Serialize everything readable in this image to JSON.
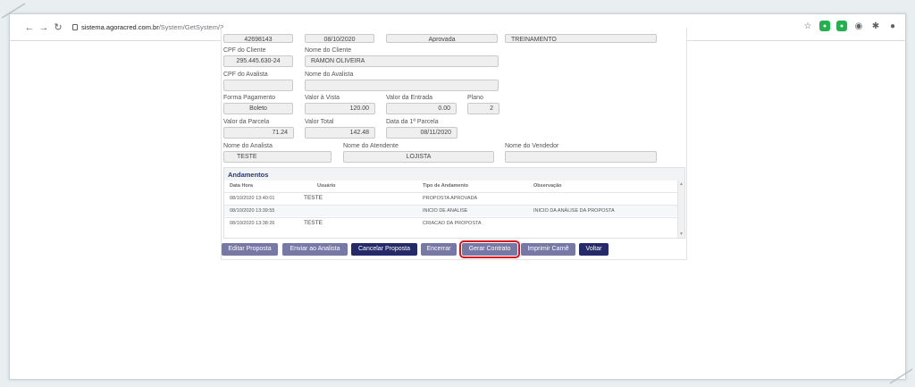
{
  "browser": {
    "url_host": "sistema.agoracred.com.br",
    "url_path": "/System/GetSystem/3"
  },
  "top_row": {
    "field1": "42698143",
    "field2": "08/10/2020",
    "field3": "Aprovada",
    "field4": "TREINAMENTO"
  },
  "cliente": {
    "cpf_label": "CPF do Cliente",
    "cpf_value": "295.445.630-24",
    "nome_label": "Nome do Cliente",
    "nome_value": "RAMON OLIVEIRA"
  },
  "avalista": {
    "cpf_label": "CPF do Avalista",
    "cpf_value": "",
    "nome_label": "Nome do Avalista",
    "nome_value": ""
  },
  "pagamento": {
    "forma_label": "Forma Pagamento",
    "forma_value": "Boleto",
    "vista_label": "Valor à Vista",
    "vista_value": "120.00",
    "entrada_label": "Valor da Entrada",
    "entrada_value": "0.00",
    "plano_label": "Plano",
    "plano_value": "2"
  },
  "parcela": {
    "valor_label": "Valor da Parcela",
    "valor_value": "71.24",
    "total_label": "Valor Total",
    "total_value": "142.48",
    "data_label": "Data da 1ª Parcela",
    "data_value": "08/11/2020"
  },
  "pessoas": {
    "analista_label": "Nome do Analista",
    "analista_value": "TESTE",
    "atendente_label": "Nome do Atendente",
    "atendente_value": "LOJISTA",
    "vendedor_label": "Nome do Vendedor",
    "vendedor_value": ""
  },
  "andamentos": {
    "title": "Andamentos",
    "columns": [
      "Data Hora",
      "Usuário",
      "Tipo de Andamento",
      "Observação"
    ],
    "rows": [
      {
        "data": "08/10/2020 13:40:01",
        "usuario": "TESTE",
        "tipo": "PROPOSTA APROVADA",
        "obs": ""
      },
      {
        "data": "08/10/2020 13:39:55",
        "usuario": "",
        "tipo": "INICIO DE ANALISE",
        "obs": "INICIO DA ANÁLISE DA PROPOSTA"
      },
      {
        "data": "08/10/2020 13:38:26",
        "usuario": "TESTE",
        "tipo": "CRIACAO DA PROPOSTA",
        "obs": ""
      }
    ]
  },
  "buttons": {
    "editar": "Editar Proposta",
    "enviar": "Enviar ao Analista",
    "cancelar": "Cancelar Proposta",
    "encerrar": "Encerrar",
    "gerar": "Gerar Contrato",
    "imprimir": "Imprimir Carnê",
    "voltar": "Voltar"
  },
  "colors": {
    "button_dark": "#252a6b",
    "button_muted": "#7878a6",
    "highlight": "#d9151e"
  }
}
